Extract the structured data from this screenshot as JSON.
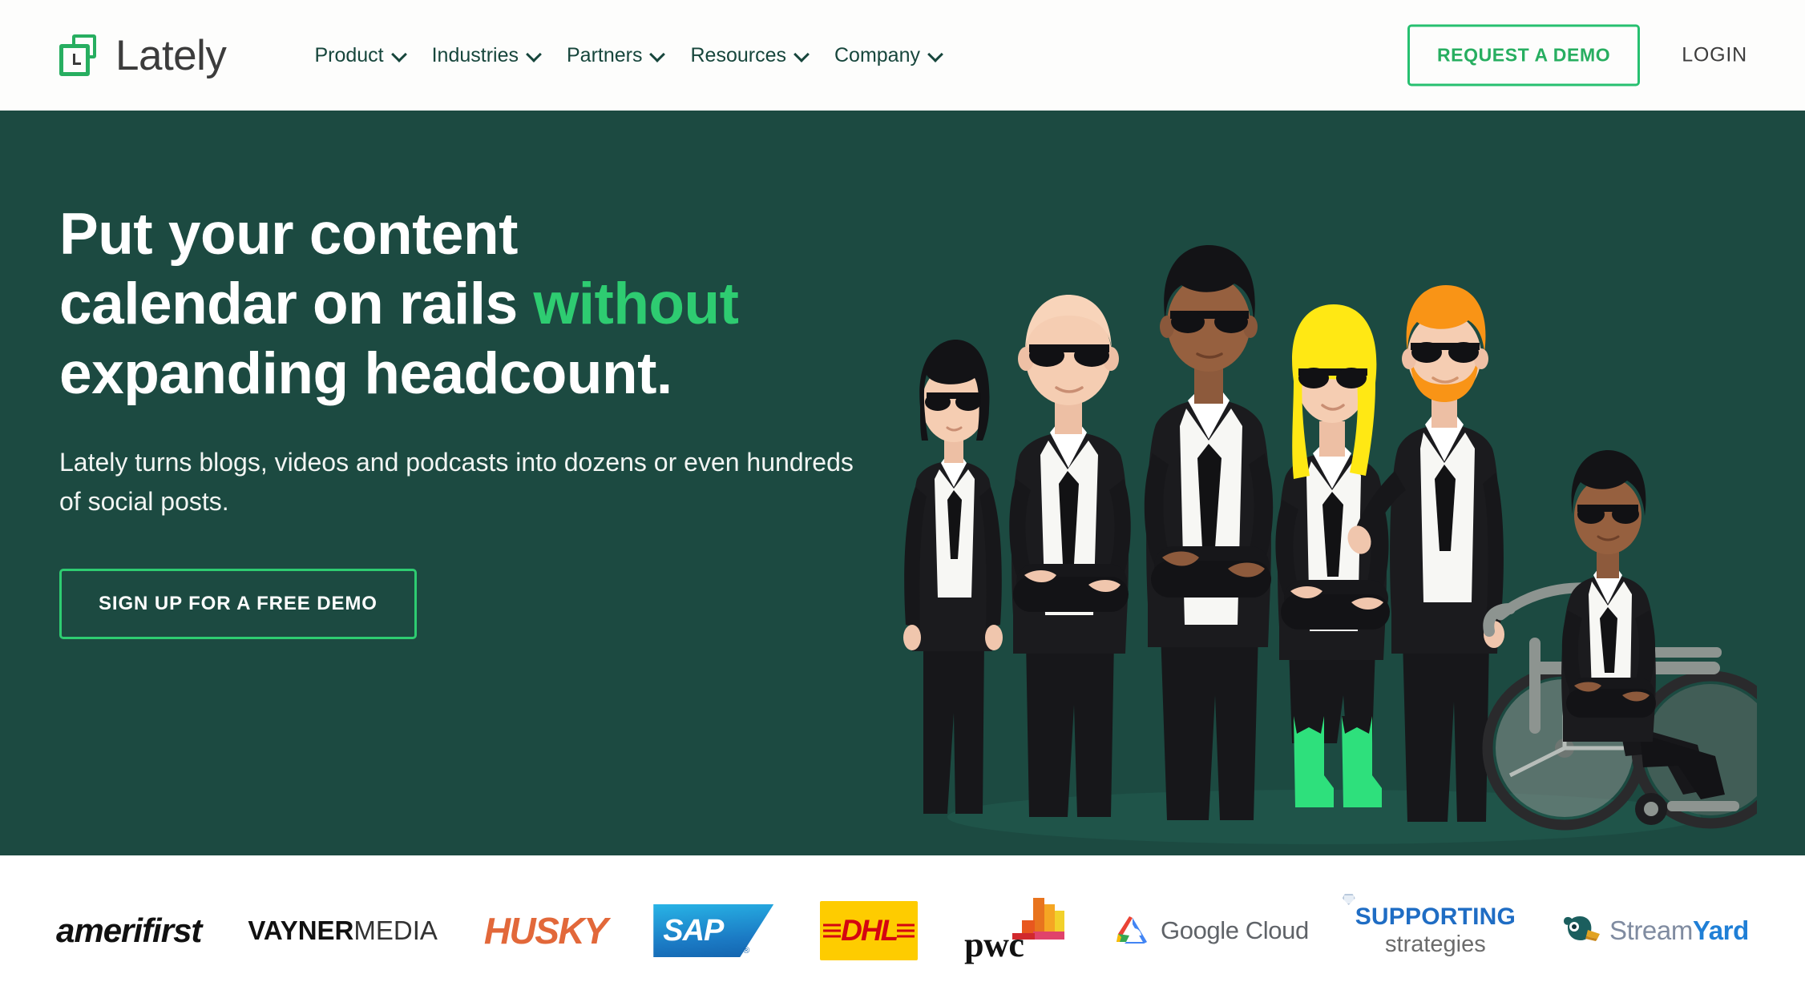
{
  "header": {
    "brand": {
      "name": "Lately",
      "icon": "lately-logo-icon",
      "color": "#27ae60"
    },
    "nav": [
      {
        "label": "Product",
        "icon": "chevron-down-icon"
      },
      {
        "label": "Industries",
        "icon": "chevron-down-icon"
      },
      {
        "label": "Partners",
        "icon": "chevron-down-icon"
      },
      {
        "label": "Resources",
        "icon": "chevron-down-icon"
      },
      {
        "label": "Company",
        "icon": "chevron-down-icon"
      }
    ],
    "request_demo_label": "REQUEST A DEMO",
    "login_label": "LOGIN",
    "accent_color": "#27ae60",
    "nav_text_color": "#17463c"
  },
  "hero": {
    "background_color": "#1c4a41",
    "title_line1": "Put your content",
    "title_line2_plain": "calendar on rails ",
    "title_line2_accent": "without",
    "title_line3": "expanding headcount.",
    "accent_color": "#2ecc71",
    "subtitle": "Lately turns blogs, videos and podcasts into dozens or even hundreds of social posts.",
    "cta_label": "SIGN UP FOR A FREE DEMO",
    "illustration": "team-in-black-suits-sunglasses-illustration"
  },
  "logos": {
    "items": [
      {
        "name": "amerifirst",
        "text": "amerifirst",
        "color": "#111111"
      },
      {
        "name": "vaynermedia",
        "text_bold": "VAYNER",
        "text_light": "MEDIA",
        "color": "#111111"
      },
      {
        "name": "husky",
        "text": "HUSKY",
        "color": "#e2683a"
      },
      {
        "name": "sap",
        "text": "SAP",
        "color": "#1b7ac4"
      },
      {
        "name": "dhl",
        "text": "DHL",
        "color": "#d40511",
        "background": "#fecc00"
      },
      {
        "name": "pwc",
        "text": "pwc",
        "color": "#111111"
      },
      {
        "name": "google-cloud",
        "text": "Google Cloud",
        "color": "#5f6368"
      },
      {
        "name": "supporting-strategies",
        "text_top": "SUPPORTING",
        "text_bottom": "strategies",
        "color": "#1f6dc4"
      },
      {
        "name": "streamyard",
        "text_a": "Stream",
        "text_b": "Yard",
        "color": "#1f7fd6"
      }
    ]
  }
}
